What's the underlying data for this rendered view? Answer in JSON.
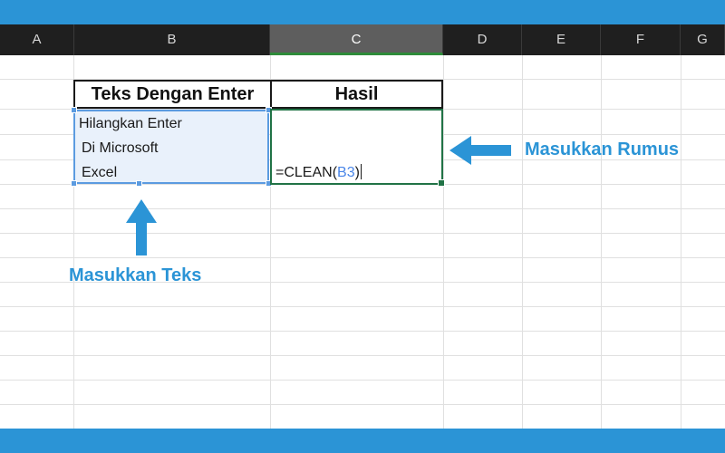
{
  "columns": [
    "A",
    "B",
    "C",
    "D",
    "E",
    "F",
    "G"
  ],
  "selected_column": "C",
  "table": {
    "header_b": "Teks Dengan Enter",
    "header_c": "Hasil",
    "text_lines": [
      "Hilangkan Enter",
      "Di Microsoft",
      "Excel"
    ],
    "formula_prefix": "=CLEAN(",
    "formula_ref": "B3",
    "formula_suffix": ")"
  },
  "annotations": {
    "right_label": "Masukkan Rumus",
    "bottom_label": "Masukkan Teks"
  },
  "colors": {
    "frame": "#2b94d6",
    "annotation": "#2b94d6",
    "selection_blue": "#5b9be0",
    "active_cell_green": "#217346"
  }
}
